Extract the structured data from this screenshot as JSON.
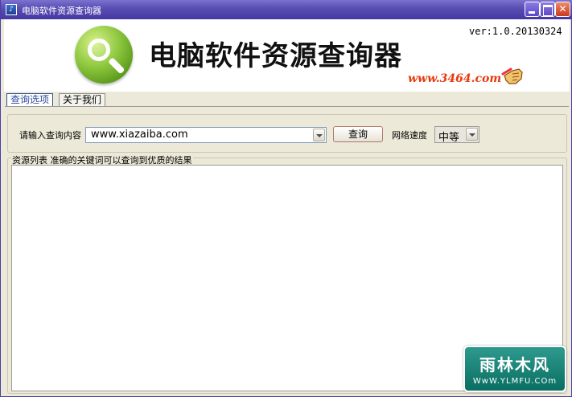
{
  "window": {
    "title": "电脑软件资源查询器"
  },
  "banner": {
    "app_title": "电脑软件资源查询器",
    "version": "ver:1.0.20130324",
    "site_link": "www.3464.com",
    "logo_icon": "magnifier-icon",
    "hand_icon": "pointing-hand-icon"
  },
  "tabs": [
    {
      "label": "查询选项",
      "active": true
    },
    {
      "label": "关于我们",
      "active": false
    }
  ],
  "search": {
    "label": "请输入查询内容",
    "value": "www.xiazaiba.com",
    "button_label": "查询",
    "speed_label": "网络速度",
    "speed_value": "中等"
  },
  "results": {
    "legend": "资源列表  准确的关键词可以查询到优质的结果"
  },
  "watermark": {
    "top": "雨林木风",
    "bottom": "WwW.YLMFU.COm"
  }
}
